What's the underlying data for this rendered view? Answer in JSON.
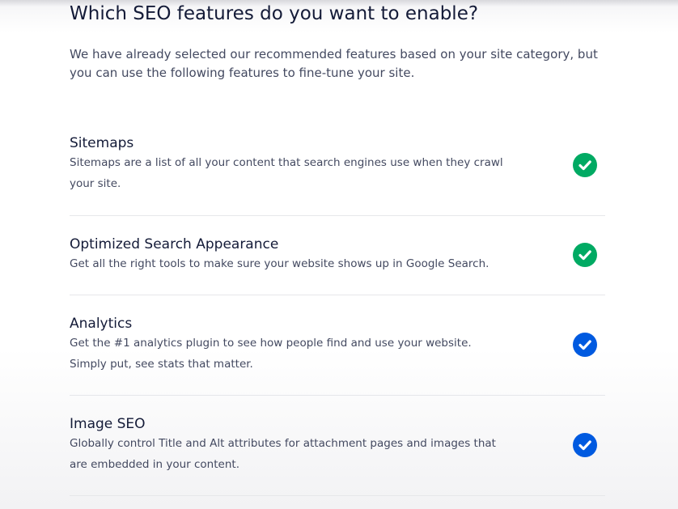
{
  "title": "Which SEO features do you want to enable?",
  "intro": "We have already selected our recommended features based on your site category, but you can use the following features to fine-tune your site.",
  "colors": {
    "check_green": "#00aa63",
    "check_blue": "#005ae0",
    "heading": "#141b38",
    "body_text": "#434960"
  },
  "features": [
    {
      "name": "Sitemaps",
      "description": "Sitemaps are a list of all your content that search engines use when they crawl your site.",
      "enabled": true,
      "check_color": "green",
      "icon": "checkmark-icon"
    },
    {
      "name": "Optimized Search Appearance",
      "description": "Get all the right tools to make sure your website shows up in Google Search.",
      "enabled": true,
      "check_color": "green",
      "icon": "checkmark-icon"
    },
    {
      "name": "Analytics",
      "description": "Get the #1 analytics plugin to see how people find and use your website. Simply put, see stats that matter.",
      "enabled": true,
      "check_color": "blue",
      "icon": "checkmark-icon"
    },
    {
      "name": "Image SEO",
      "description": "Globally control Title and Alt attributes for attachment pages and images that are embedded in your content.",
      "enabled": true,
      "check_color": "blue",
      "icon": "checkmark-icon"
    }
  ]
}
